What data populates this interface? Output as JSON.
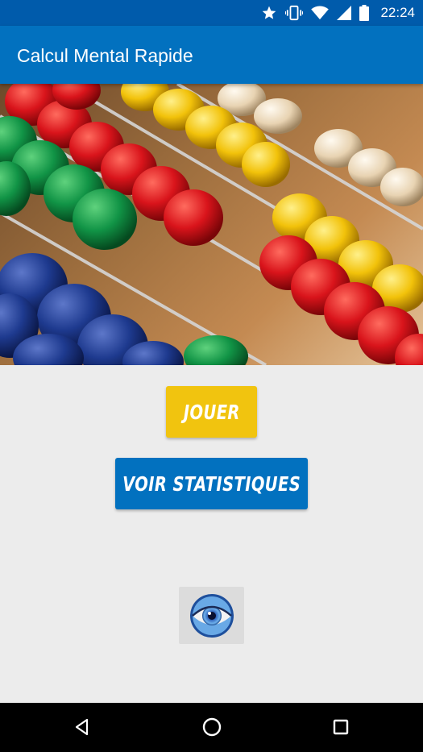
{
  "status_bar": {
    "time": "22:24",
    "icons": [
      "star-icon",
      "vibrate-icon",
      "wifi-icon",
      "signal-icon",
      "battery-icon"
    ]
  },
  "app_bar": {
    "title": "Calcul Mental Rapide"
  },
  "hero": {
    "image": "abacus-photo"
  },
  "main": {
    "play_label": "JOUER",
    "stats_label": "VOIR STATISTIQUES",
    "logo": "eye-logo"
  },
  "nav": {
    "icons": [
      "back-icon",
      "home-icon",
      "recent-apps-icon"
    ]
  },
  "colors": {
    "status_bar": "#005bab",
    "app_bar": "#0271bf",
    "play_button": "#f1c40f",
    "stats_button": "#0271bf",
    "background": "#ececec"
  }
}
